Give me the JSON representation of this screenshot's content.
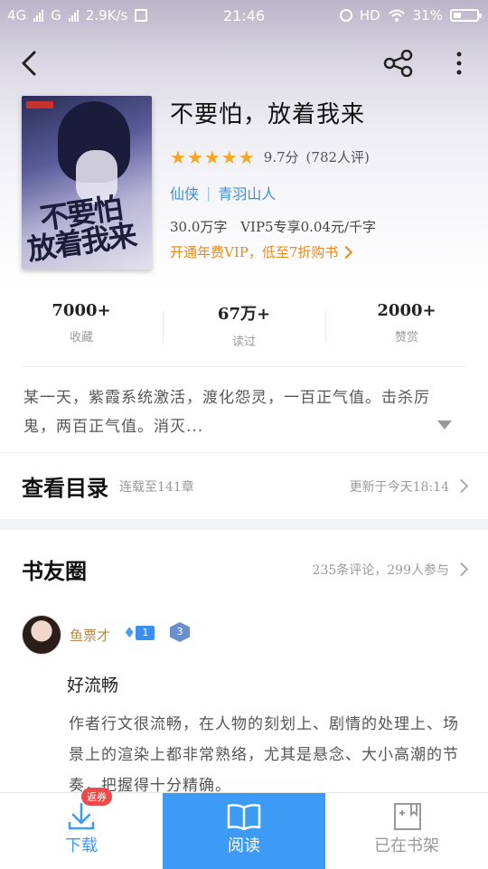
{
  "status_bar": {
    "network": "4G",
    "network2": "G",
    "speed": "2.9K/s",
    "time": "21:46",
    "hd": "HD",
    "battery": "31%"
  },
  "book": {
    "title": "不要怕，放着我来",
    "cover_title_line1": "不要怕",
    "cover_title_line2": "放着我来",
    "rating_stars": 5,
    "score": "9.7分",
    "reviews": "(782人评)",
    "genre": "仙侠",
    "author": "青羽山人",
    "word_count": "30.0万字",
    "price": "VIP5专享0.04元/千字",
    "vip_promo": "开通年费VIP，低至7折购书"
  },
  "stats": [
    {
      "value": "7000+",
      "label": "收藏"
    },
    {
      "value": "67万+",
      "label": "读过"
    },
    {
      "value": "2000+",
      "label": "赞赏"
    }
  ],
  "description": "某一天，紫霞系统激活，渡化怨灵，一百正气值。击杀厉鬼，两百正气值。消灭...",
  "catalog": {
    "title": "查看目录",
    "status": "连载至141章",
    "updated": "更新于今天18:14"
  },
  "circle": {
    "title": "书友圈",
    "summary": "235条评论，299人参与"
  },
  "comment": {
    "username": "鱼票才",
    "fan_level": "1",
    "medal_level": "3",
    "title": "好流畅",
    "body": "作者行文很流畅，在人物的刻划上、剧情的处理上、场景上的渲染上都非常熟络，尤其是悬念、大小高潮的节奏，把握得十分精确。"
  },
  "bottom_bar": {
    "download": "下载",
    "download_badge": "返券",
    "read": "阅读",
    "shelf": "已在书架"
  },
  "colors": {
    "accent_blue": "#3d9af5",
    "star": "#f5a623",
    "promo_orange": "#e8891e",
    "badge_red": "#f1494a"
  }
}
